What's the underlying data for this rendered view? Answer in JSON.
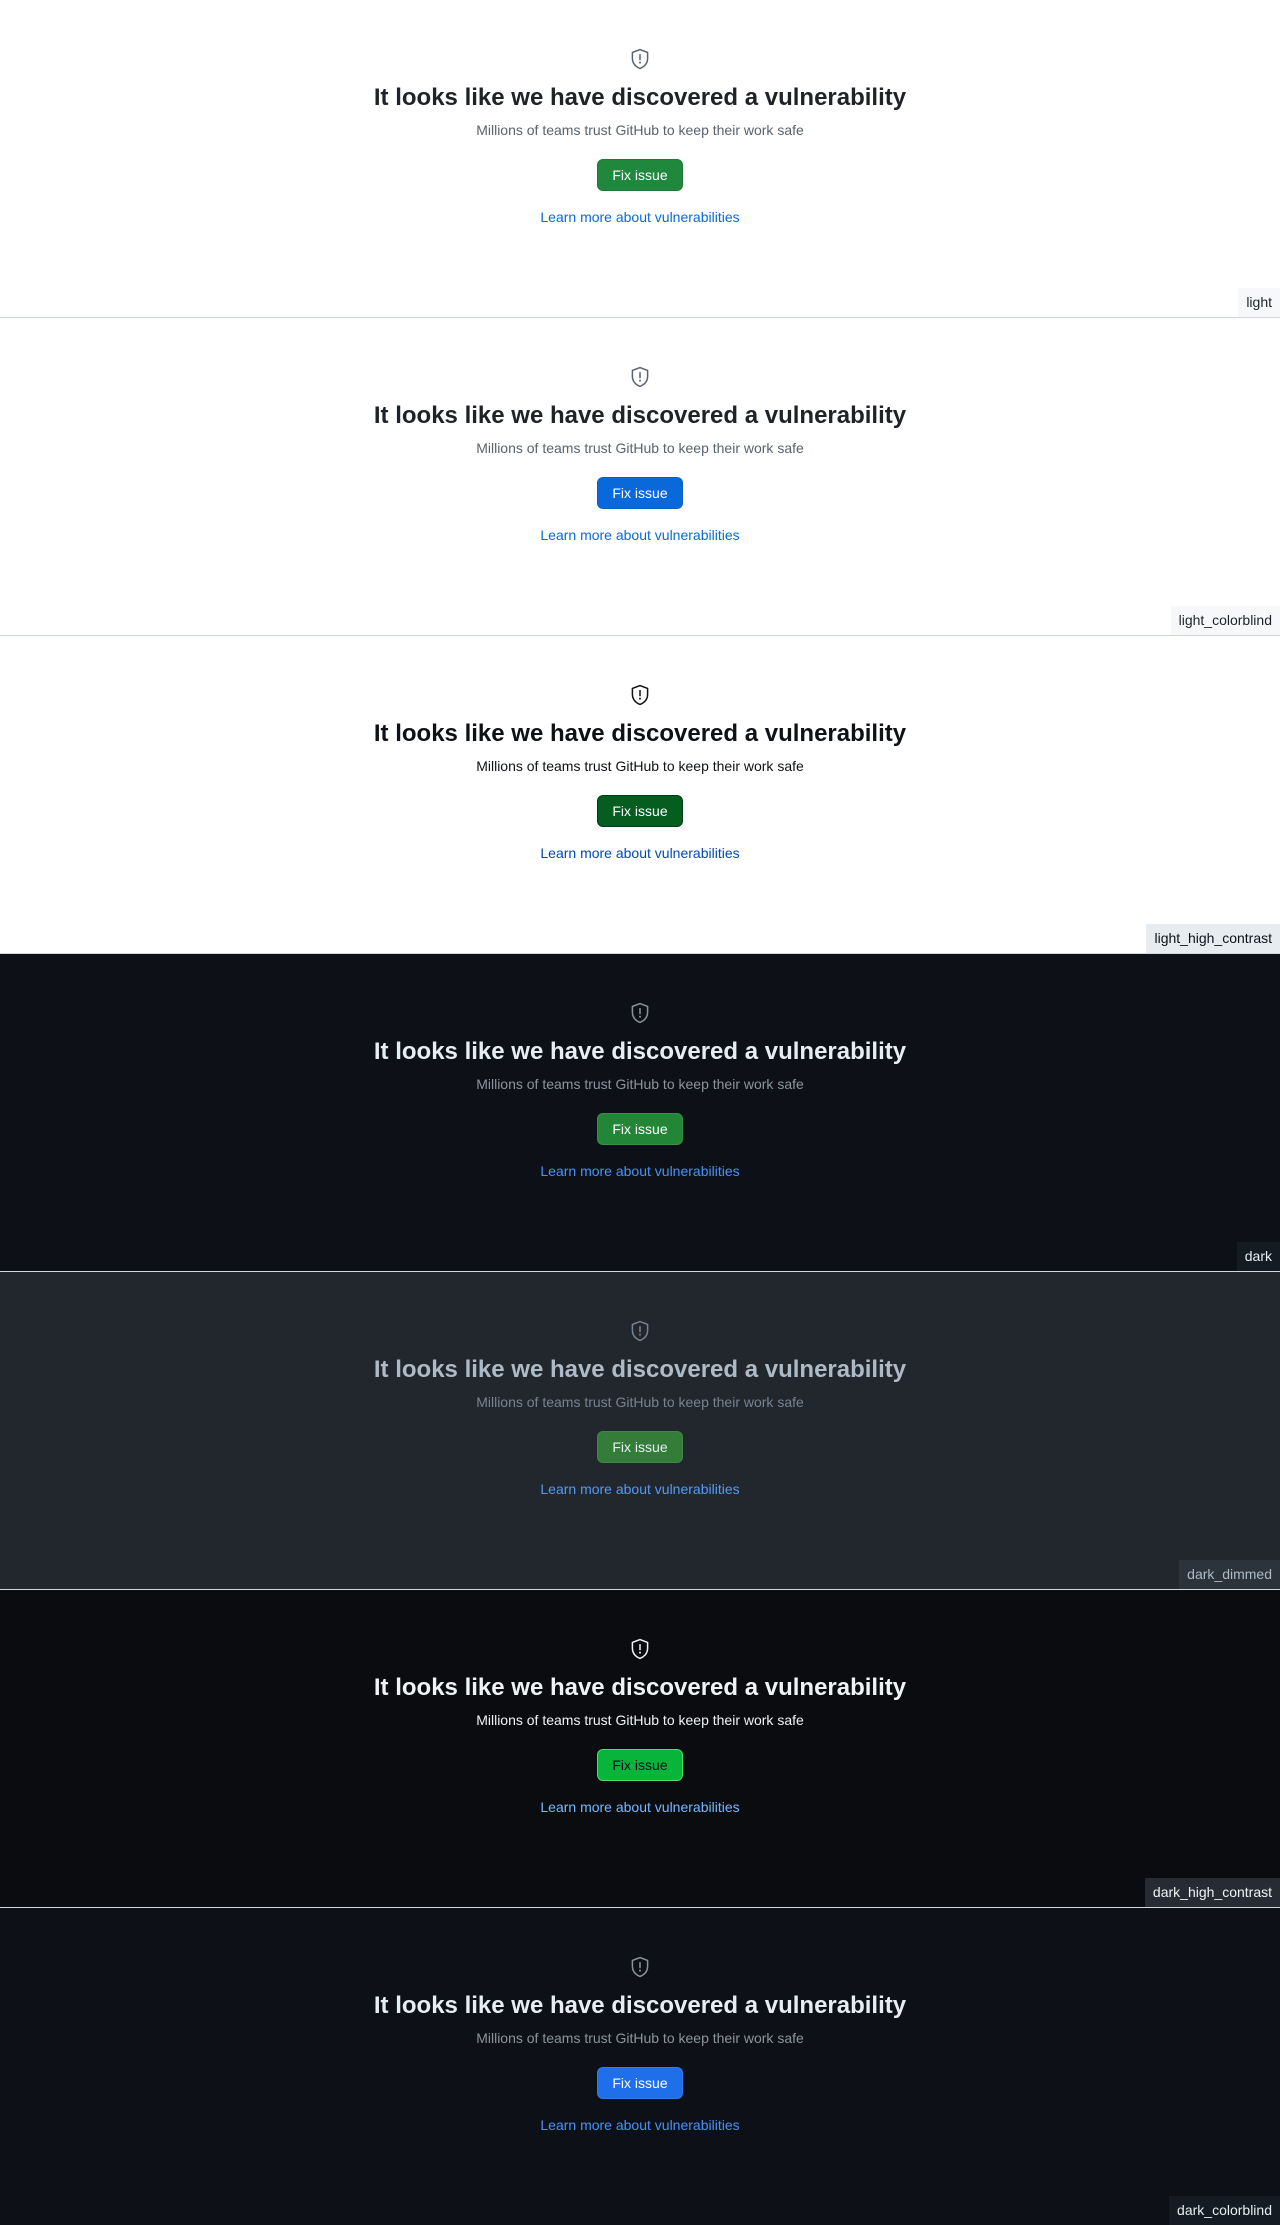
{
  "blankslate": {
    "icon": "shield-alert-icon",
    "heading": "It looks like we have discovered a vulnerability",
    "description": "Millions of teams trust GitHub to keep their work safe",
    "primary_action_label": "Fix issue",
    "secondary_action_label": "Learn more about vulnerabilities"
  },
  "themes": [
    {
      "id": "light",
      "label": "light",
      "colors": {
        "background": "#ffffff",
        "button": "#1f883d",
        "link": "#0969da"
      }
    },
    {
      "id": "light_colorblind",
      "label": "light_colorblind",
      "colors": {
        "background": "#ffffff",
        "button": "#0969da",
        "link": "#0969da"
      }
    },
    {
      "id": "light_high_contrast",
      "label": "light_high_contrast",
      "colors": {
        "background": "#ffffff",
        "button": "#055d20",
        "link": "#0349b4"
      }
    },
    {
      "id": "dark",
      "label": "dark",
      "colors": {
        "background": "#0d1117",
        "button": "#238636",
        "link": "#4493f8"
      }
    },
    {
      "id": "dark_dimmed",
      "label": "dark_dimmed",
      "colors": {
        "background": "#22272e",
        "button": "#347d39",
        "link": "#539bf5"
      }
    },
    {
      "id": "dark_high_contrast",
      "label": "dark_high_contrast",
      "colors": {
        "background": "#0a0c10",
        "button": "#09b43a",
        "link": "#74b9ff"
      }
    },
    {
      "id": "dark_colorblind",
      "label": "dark_colorblind",
      "colors": {
        "background": "#0d1117",
        "button": "#1f6feb",
        "link": "#4493f8"
      }
    }
  ]
}
